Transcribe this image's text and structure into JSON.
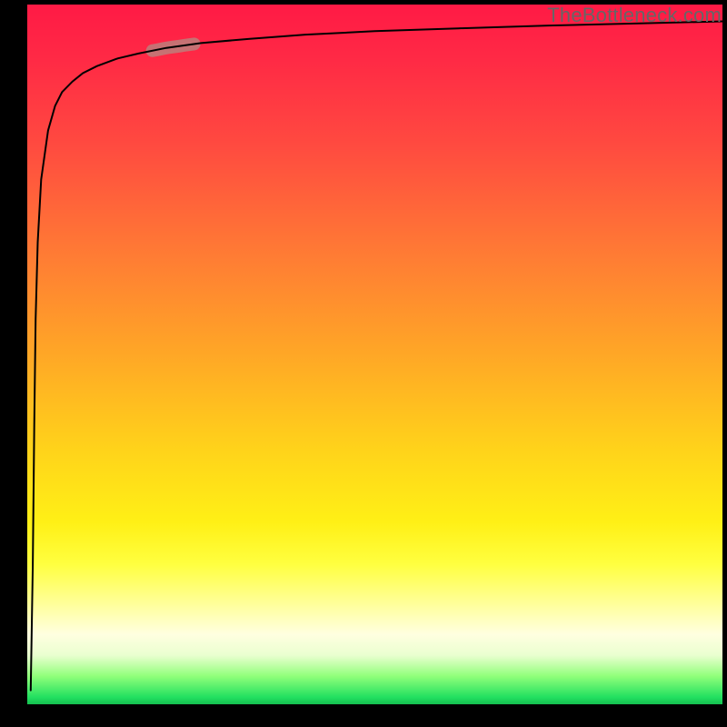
{
  "watermark": "TheBottleneck.com",
  "colors": {
    "frame": "#000000",
    "curve": "#000000",
    "highlight": "#c07a78",
    "watermark_text": "#666666"
  },
  "chart_data": {
    "type": "line",
    "title": "",
    "xlabel": "",
    "ylabel": "",
    "xlim": [
      0,
      100
    ],
    "ylim": [
      0,
      100
    ],
    "grid": false,
    "legend": false,
    "series": [
      {
        "name": "bottleneck-curve",
        "x": [
          0.5,
          0.8,
          1.0,
          1.2,
          1.5,
          2.0,
          3.0,
          4.0,
          5.0,
          6.5,
          8.0,
          10.0,
          13.0,
          16.0,
          20.0,
          25.0,
          32.0,
          40.0,
          50.0,
          62.0,
          75.0,
          88.0,
          100.0
        ],
        "y": [
          2.0,
          20.0,
          40.0,
          55.0,
          66.0,
          75.0,
          82.0,
          85.5,
          87.5,
          89.0,
          90.2,
          91.2,
          92.3,
          93.0,
          93.8,
          94.5,
          95.1,
          95.7,
          96.2,
          96.6,
          97.0,
          97.3,
          97.6
        ]
      }
    ],
    "annotations": [
      {
        "name": "highlight-segment",
        "x_start": 18.0,
        "x_end": 24.0,
        "note": "thick muted-red segment on curve"
      }
    ]
  }
}
